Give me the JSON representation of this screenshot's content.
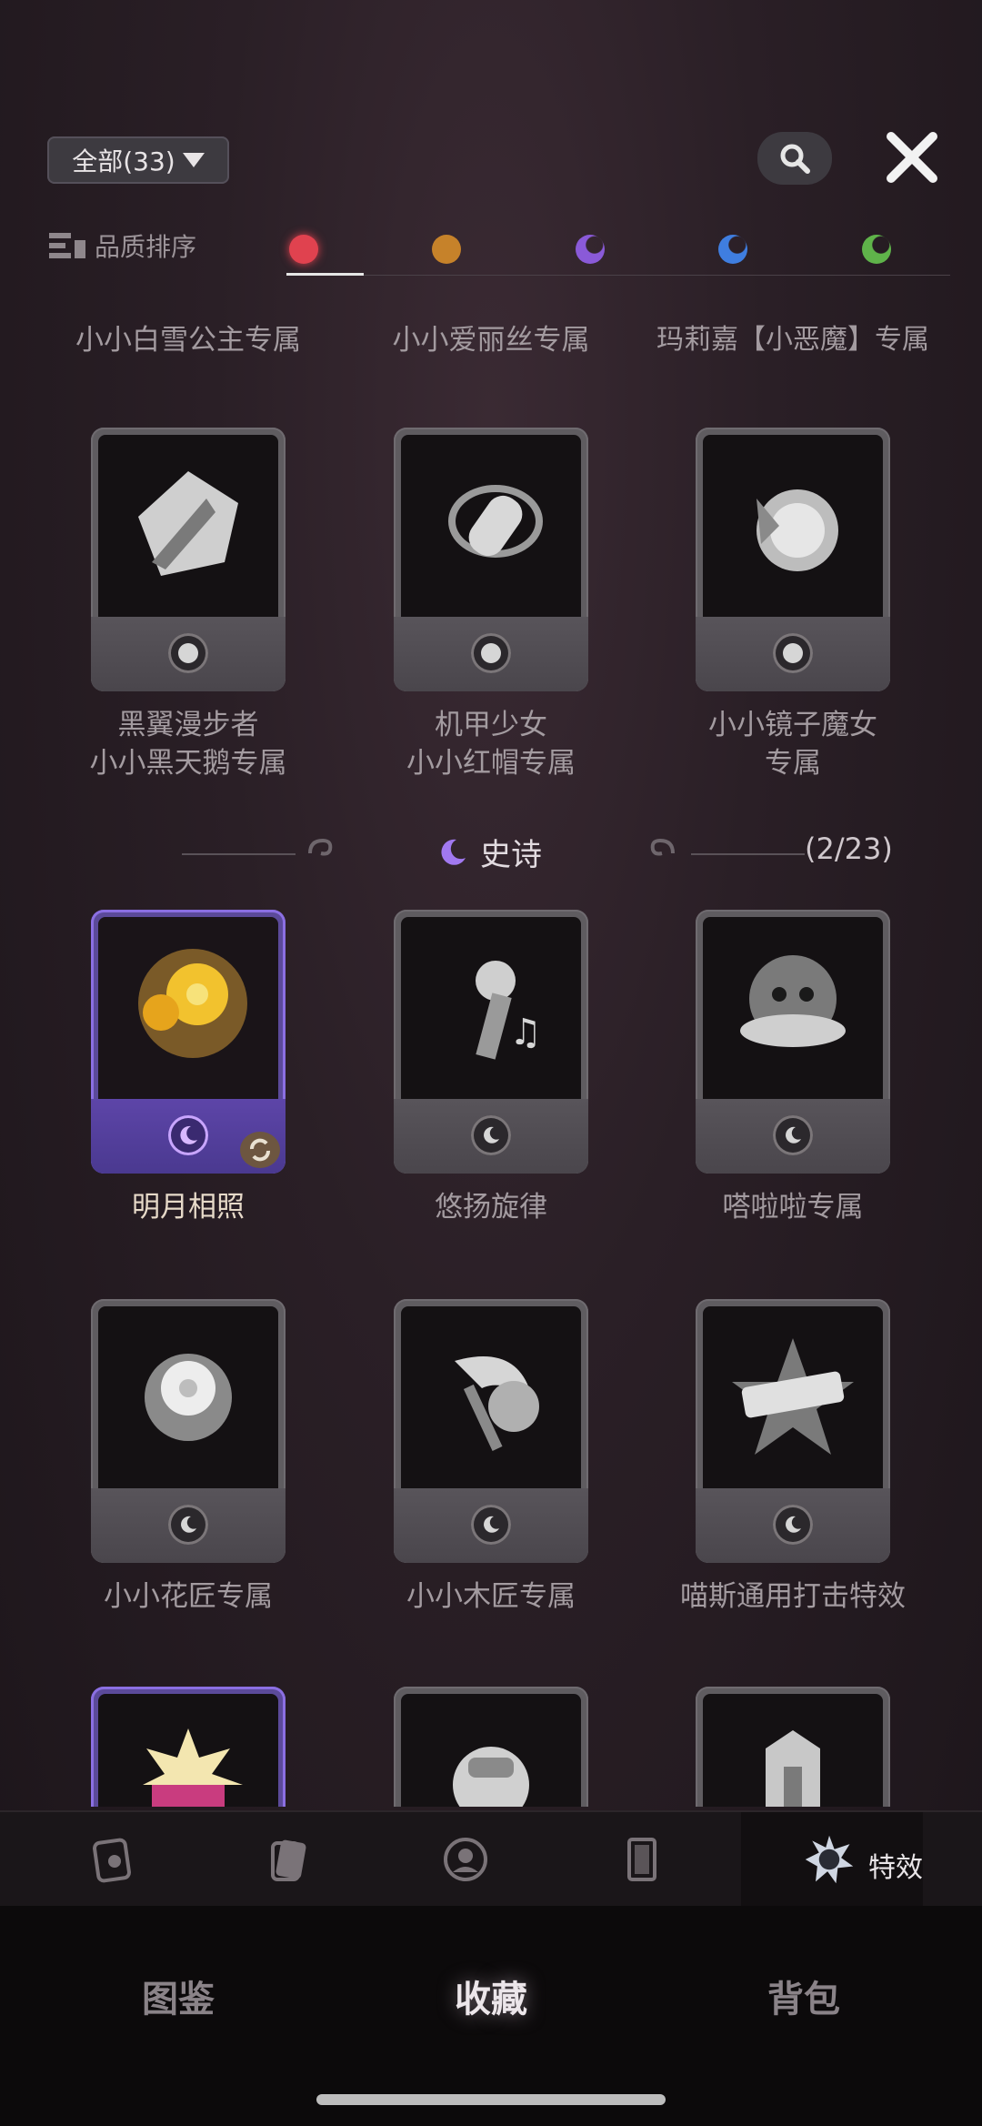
{
  "filter": {
    "label": "全部(33)"
  },
  "sort": {
    "label": "品质排序",
    "qualities": [
      {
        "name": "red",
        "color": "#e0424f"
      },
      {
        "name": "orange",
        "color": "#c6822a"
      },
      {
        "name": "purple-moon",
        "color": "#8a5ad8"
      },
      {
        "name": "blue-moon",
        "color": "#3f7ee0"
      },
      {
        "name": "green-moon",
        "color": "#5fb34a"
      }
    ]
  },
  "row0_titles": [
    "小小白雪公主专属",
    "小小爱丽丝专属",
    "玛莉嘉【小恶魔】专属"
  ],
  "row1": [
    {
      "line1": "黑翼漫步者",
      "line2": "小小黑天鹅专属"
    },
    {
      "line1": "机甲少女",
      "line2": "小小红帽专属"
    },
    {
      "line1": "小小镜子魔女",
      "line2": "专属"
    }
  ],
  "section": {
    "title": "史诗",
    "count": "(2/23)"
  },
  "row2_titles": [
    "明月相照",
    "悠扬旋律",
    "嗒啦啦专属"
  ],
  "row3_titles": [
    "小小花匠专属",
    "小小木匠专属",
    "喵斯通用打击特效"
  ],
  "tabbar": {
    "active_label": "特效"
  },
  "bottom_nav": {
    "items": [
      "图鉴",
      "收藏",
      "背包"
    ]
  }
}
